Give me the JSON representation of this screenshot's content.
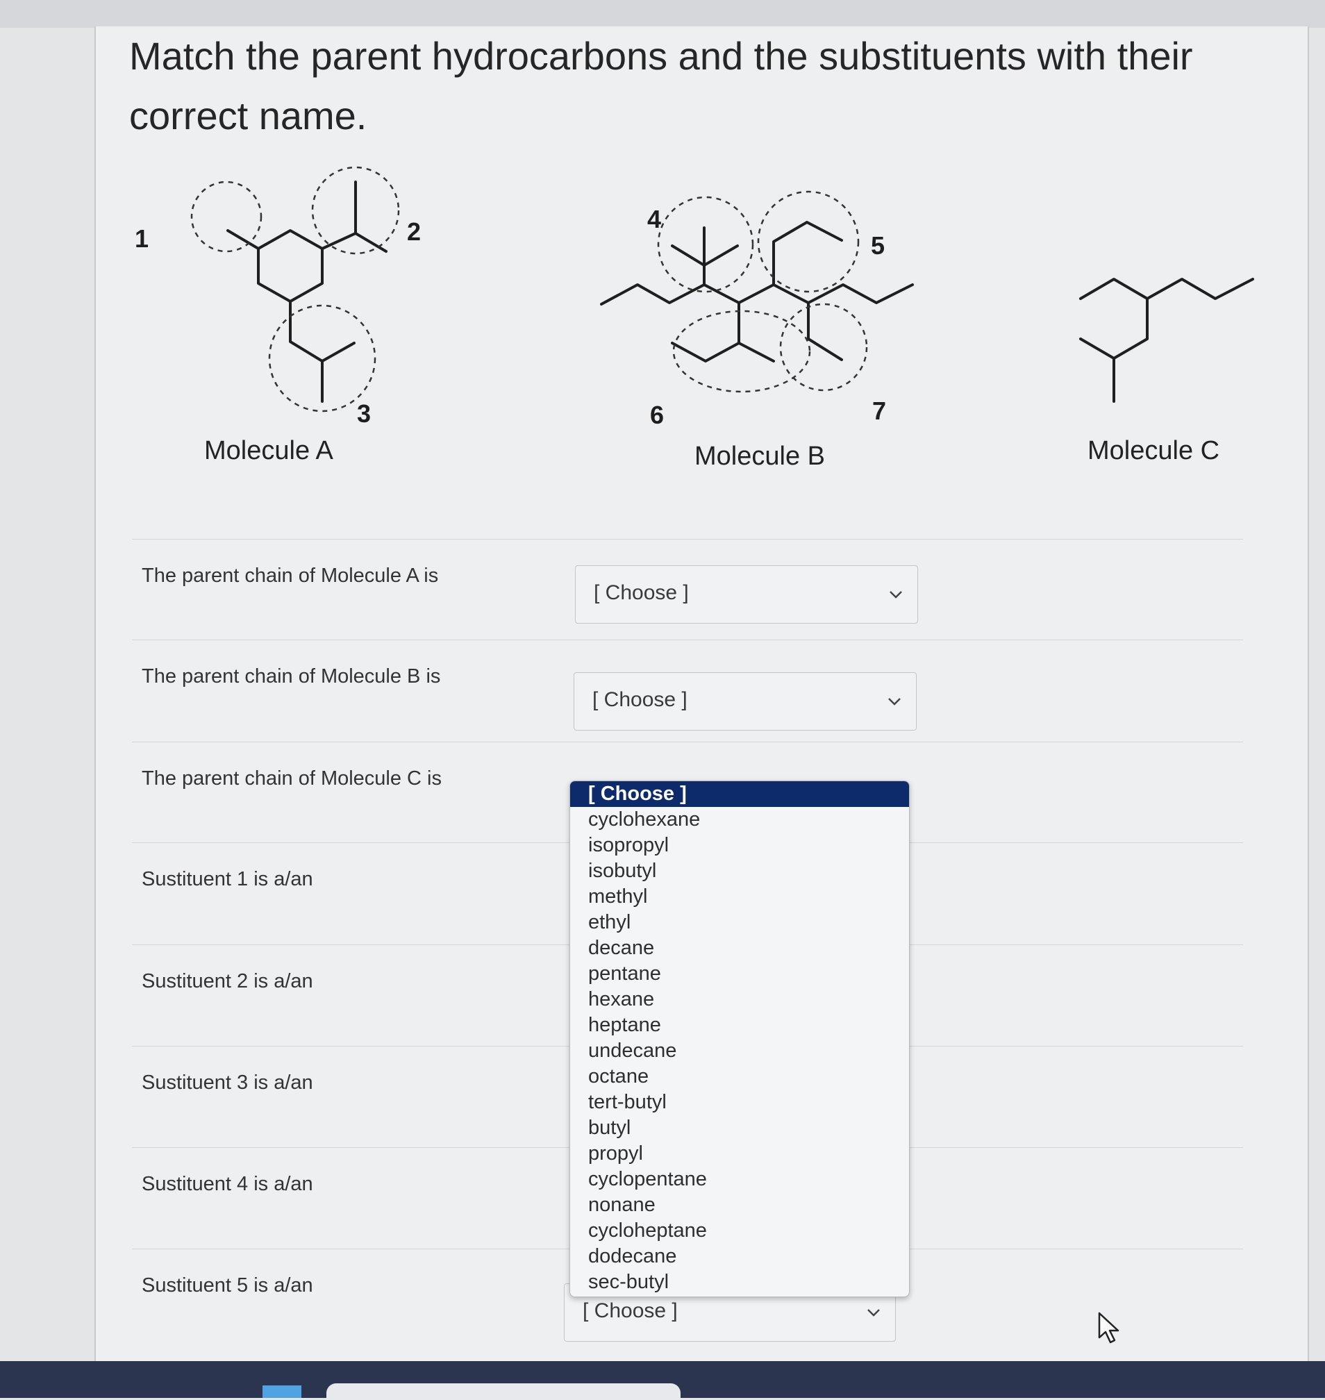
{
  "title": "Match the parent hydrocarbons and the substituents with their correct name.",
  "molecules": {
    "a_label": "Molecule A",
    "b_label": "Molecule B",
    "c_label": "Molecule C",
    "substituent_numbers": [
      "1",
      "2",
      "3",
      "4",
      "5",
      "6",
      "7"
    ]
  },
  "questions": [
    {
      "prompt": "The parent chain of Molecule A is",
      "value": "[ Choose ]"
    },
    {
      "prompt": "The parent chain of Molecule B is",
      "value": "[ Choose ]"
    },
    {
      "prompt": "The parent chain of Molecule C is",
      "value": "[ Choose ]"
    },
    {
      "prompt": "Sustituent 1 is a/an",
      "value": ""
    },
    {
      "prompt": "Sustituent 2 is a/an",
      "value": ""
    },
    {
      "prompt": "Sustituent 3 is a/an",
      "value": ""
    },
    {
      "prompt": "Sustituent 4 is a/an",
      "value": ""
    },
    {
      "prompt": "Sustituent 5 is a/an",
      "value": "[ Choose ]"
    }
  ],
  "dropdown": {
    "options": [
      "[ Choose ]",
      "cyclohexane",
      "isopropyl",
      "isobutyl",
      "methyl",
      "ethyl",
      "decane",
      "pentane",
      "hexane",
      "heptane",
      "undecane",
      "octane",
      "tert-butyl",
      "butyl",
      "propyl",
      "cyclopentane",
      "nonane",
      "cycloheptane",
      "dodecane",
      "sec-butyl"
    ],
    "selected_index": 0
  },
  "icons": [
    "chevron-down-icon",
    "mouse-cursor-icon"
  ],
  "colors": {
    "selected_option_bg": "#0d2a6b",
    "page_bg": "#eeeff1"
  }
}
